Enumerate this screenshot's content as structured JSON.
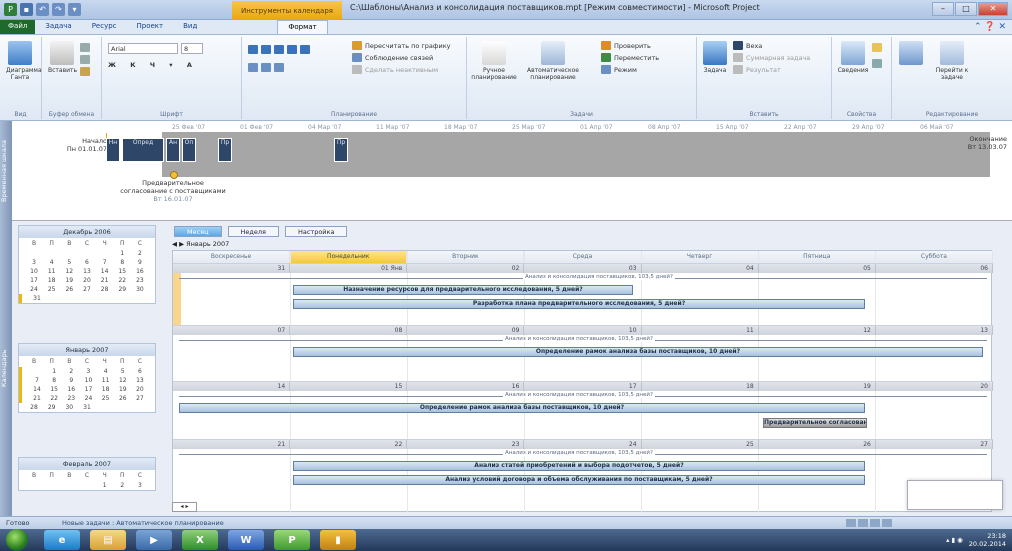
{
  "window": {
    "title": "C:\\Шаблоны\\Анализ и консолидация поставщиков.mpt [Режим совместимости] - Microsoft Project",
    "context_tab": "Инструменты календаря"
  },
  "ribbon_tabs": [
    "Файл",
    "Задача",
    "Ресурс",
    "Проект",
    "Вид",
    "Формат"
  ],
  "ribbon_groups": [
    {
      "name": "Вид",
      "buttons": [
        "Диаграмма Ганта"
      ]
    },
    {
      "name": "Буфер обмена",
      "buttons": [
        "Вставить"
      ]
    },
    {
      "name": "Шрифт",
      "buttons": [
        "Arial",
        "8"
      ]
    },
    {
      "name": "Планирование",
      "buttons": [
        "Пересчитать по графику",
        "Соблюдение связей",
        "Сделать неактивным"
      ]
    },
    {
      "name": "Задачи",
      "buttons": [
        "Ручное планирование",
        "Автоматическое планирование",
        "Проверить",
        "Переместить",
        "Режим"
      ]
    },
    {
      "name": "Вставить",
      "buttons": [
        "Задача",
        "Веха",
        "Суммарная задача",
        "Результат"
      ]
    },
    {
      "name": "Свойства",
      "buttons": [
        "Сведения"
      ]
    },
    {
      "name": "Редактирование",
      "buttons": [
        "Перейти к задаче"
      ]
    }
  ],
  "side_labels": {
    "timeline": "Временная шкала",
    "calendar": "Календарь"
  },
  "timeline": {
    "start_label": "Начало",
    "start_date": "Пн 01.01.07",
    "end_label": "Окончание",
    "end_date": "Вт 13.03.07",
    "dates": [
      "25 Фев '07",
      "01 Фев '07",
      "04 Мар '07",
      "11 Мар '07",
      "18 Мар '07",
      "25 Мар '07",
      "01 Апр '07",
      "08 Апр '07",
      "15 Апр '07",
      "22 Апр '07",
      "29 Апр '07",
      "06 Май '07"
    ],
    "callout": "Предварительное согласование с поставщиками",
    "callout_date": "Вт 16.01.07",
    "tasks": [
      "Нн",
      "Опред",
      "Ан",
      "Оп",
      "Пр",
      "Пр"
    ]
  },
  "view_tabs": [
    "Месяц",
    "Неделя",
    "Настройка"
  ],
  "month_label": "Январь 2007",
  "day_headers": [
    "Воскресенье",
    "Понедельник",
    "Вторник",
    "Среда",
    "Четверг",
    "Пятница",
    "Суббота"
  ],
  "weeks": [
    {
      "days": [
        "31",
        "01 Янв",
        "02",
        "03",
        "04",
        "05",
        "06"
      ],
      "summary": "Анализ и консолидация поставщиков, 103,5 дней?",
      "bars": [
        "Назначение ресурсов для предварительного исследования, 5 дней?",
        "Разработка плана предварительного исследования, 5 дней?"
      ]
    },
    {
      "days": [
        "07",
        "08",
        "09",
        "10",
        "11",
        "12",
        "13"
      ],
      "summary": "Анализ и консолидация поставщиков, 103,5 дней?",
      "bars": [
        "Определение рамок анализа базы поставщиков, 10 дней?"
      ]
    },
    {
      "days": [
        "14",
        "15",
        "16",
        "17",
        "18",
        "19",
        "20"
      ],
      "summary": "Анализ и консолидация поставщиков, 103,5 дней?",
      "bars": [
        "Определение рамок анализа базы поставщиков, 10 дней?",
        "Предварительное согласование"
      ]
    },
    {
      "days": [
        "21",
        "22",
        "23",
        "24",
        "25",
        "26",
        "27"
      ],
      "summary": "Анализ и консолидация поставщиков, 103,5 дней?",
      "bars": [
        "Анализ статей приобретений и выбора подотчетов, 5 дней?",
        "Анализ условий договора и объема обслуживания по поставщикам, 5 дней?"
      ]
    }
  ],
  "minicals": [
    {
      "title": "Декабрь 2006",
      "weekdays": [
        "В",
        "П",
        "В",
        "С",
        "Ч",
        "П",
        "С"
      ],
      "rows": [
        [
          "",
          "",
          "",
          "",
          "",
          "1",
          "2"
        ],
        [
          "3",
          "4",
          "5",
          "6",
          "7",
          "8",
          "9"
        ],
        [
          "10",
          "11",
          "12",
          "13",
          "14",
          "15",
          "16"
        ],
        [
          "17",
          "18",
          "19",
          "20",
          "21",
          "22",
          "23"
        ],
        [
          "24",
          "25",
          "26",
          "27",
          "28",
          "29",
          "30"
        ],
        [
          "31",
          "",
          "",
          "",
          "",
          "",
          ""
        ]
      ]
    },
    {
      "title": "Январь 2007",
      "weekdays": [
        "В",
        "П",
        "В",
        "С",
        "Ч",
        "П",
        "С"
      ],
      "rows": [
        [
          "",
          "1",
          "2",
          "3",
          "4",
          "5",
          "6"
        ],
        [
          "7",
          "8",
          "9",
          "10",
          "11",
          "12",
          "13"
        ],
        [
          "14",
          "15",
          "16",
          "17",
          "18",
          "19",
          "20"
        ],
        [
          "21",
          "22",
          "23",
          "24",
          "25",
          "26",
          "27"
        ],
        [
          "28",
          "29",
          "30",
          "31",
          "",
          "",
          ""
        ]
      ]
    },
    {
      "title": "Февраль 2007",
      "weekdays": [
        "В",
        "П",
        "В",
        "С",
        "Ч",
        "П",
        "С"
      ],
      "rows": [
        [
          "",
          "",
          "",
          "",
          "1",
          "2",
          "3"
        ]
      ]
    }
  ],
  "status": {
    "ready": "Готово",
    "new_tasks": "Новые задачи : Автоматическое планирование"
  },
  "taskbar": {
    "time": "23:18",
    "date": "20.02.2014"
  },
  "colors": {
    "accent": "#1e6a2c",
    "context_tab": "#e9a70e",
    "task_bar": "#2e4667",
    "today": "#f6c83b"
  }
}
